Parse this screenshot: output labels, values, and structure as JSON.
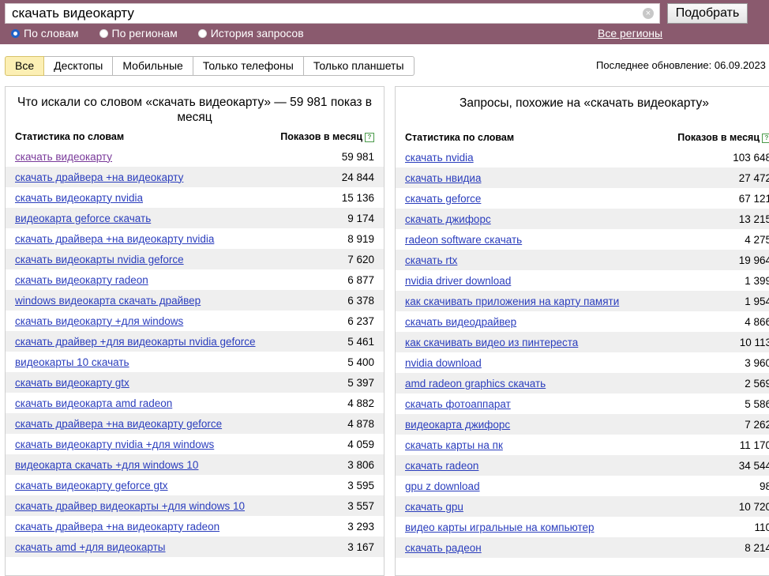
{
  "search": {
    "value": "скачать видеокарту",
    "submit_label": "Подобрать",
    "clear_glyph": "×",
    "modes": [
      {
        "label": "По словам",
        "checked": true
      },
      {
        "label": "По регионам",
        "checked": false
      },
      {
        "label": "История запросов",
        "checked": false
      }
    ],
    "regions_label": "Все регионы"
  },
  "tabs": [
    "Все",
    "Десктопы",
    "Мобильные",
    "Только телефоны",
    "Только планшеты"
  ],
  "update_info": "Последнее обновление: 06.09.2023",
  "left": {
    "title": "Что искали со словом «скачать видеокарту» — 59 981 показ в месяц",
    "col_keyword": "Статистика по словам",
    "col_count": "Показов в месяц",
    "help_glyph": "?",
    "rows": [
      {
        "kw": "скачать видеокарту",
        "n": "59 981"
      },
      {
        "kw": "скачать драйвера +на видеокарту",
        "n": "24 844"
      },
      {
        "kw": "скачать видеокарту nvidia",
        "n": "15 136"
      },
      {
        "kw": "видеокарта geforce скачать",
        "n": "9 174"
      },
      {
        "kw": "скачать драйвера +на видеокарту nvidia",
        "n": "8 919"
      },
      {
        "kw": "скачать видеокарты nvidia geforce",
        "n": "7 620"
      },
      {
        "kw": "скачать видеокарту radeon",
        "n": "6 877"
      },
      {
        "kw": "windows видеокарта скачать драйвер",
        "n": "6 378"
      },
      {
        "kw": "скачать видеокарту +для windows",
        "n": "6 237"
      },
      {
        "kw": "скачать драйвер +для видеокарты nvidia geforce",
        "n": "5 461"
      },
      {
        "kw": "видеокарты 10 скачать",
        "n": "5 400"
      },
      {
        "kw": "скачать видеокарту gtx",
        "n": "5 397"
      },
      {
        "kw": "скачать видеокарта amd radeon",
        "n": "4 882"
      },
      {
        "kw": "скачать драйвера +на видеокарту geforce",
        "n": "4 878"
      },
      {
        "kw": "скачать видеокарту nvidia +для windows",
        "n": "4 059"
      },
      {
        "kw": "видеокарта скачать +для windows 10",
        "n": "3 806"
      },
      {
        "kw": "скачать видеокарту geforce gtx",
        "n": "3 595"
      },
      {
        "kw": "скачать драйвер видеокарты +для windows 10",
        "n": "3 557"
      },
      {
        "kw": "скачать драйвера +на видеокарту radeon",
        "n": "3 293"
      },
      {
        "kw": "скачать amd +для видеокарты",
        "n": "3 167"
      }
    ]
  },
  "right": {
    "title": "Запросы, похожие на «скачать видеокарту»",
    "col_keyword": "Статистика по словам",
    "col_count": "Показов в месяц",
    "help_glyph": "?",
    "rows": [
      {
        "kw": "скачать nvidia",
        "n": "103 648"
      },
      {
        "kw": "скачать нвидиа",
        "n": "27 472"
      },
      {
        "kw": "скачать geforce",
        "n": "67 121"
      },
      {
        "kw": "скачать джифорс",
        "n": "13 215"
      },
      {
        "kw": "radeon software скачать",
        "n": "4 275"
      },
      {
        "kw": "скачать rtx",
        "n": "19 964"
      },
      {
        "kw": "nvidia driver download",
        "n": "1 399"
      },
      {
        "kw": "как скачивать приложения на карту памяти",
        "n": "1 954"
      },
      {
        "kw": "скачать видеодрайвер",
        "n": "4 866"
      },
      {
        "kw": "как скачивать видео из пинтереста",
        "n": "10 113"
      },
      {
        "kw": "nvidia download",
        "n": "3 960"
      },
      {
        "kw": "amd radeon graphics скачать",
        "n": "2 569"
      },
      {
        "kw": "скачать фотоаппарат",
        "n": "5 586"
      },
      {
        "kw": "видеокарта джифорс",
        "n": "7 262"
      },
      {
        "kw": "скачать карты на пк",
        "n": "11 170"
      },
      {
        "kw": "скачать radeon",
        "n": "34 544"
      },
      {
        "kw": "gpu z download",
        "n": "98"
      },
      {
        "kw": "скачать gpu",
        "n": "10 720"
      },
      {
        "kw": "видео карты игральные на компьютер",
        "n": "110"
      },
      {
        "kw": "скачать радеон",
        "n": "8 214"
      }
    ]
  }
}
